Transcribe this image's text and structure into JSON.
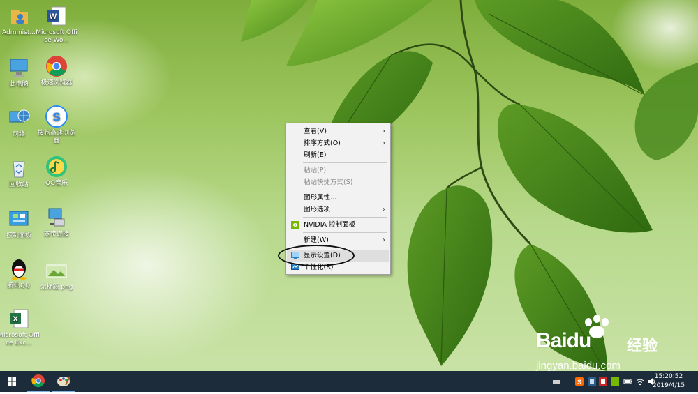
{
  "desktop_icons": [
    {
      "id": "administrator",
      "label": "Administ...",
      "icon": "user-folder-icon"
    },
    {
      "id": "word",
      "label": "Microsoft Office Wo...",
      "icon": "word-icon"
    },
    {
      "id": "this-pc",
      "label": "此电脑",
      "icon": "computer-icon"
    },
    {
      "id": "chrome",
      "label": "极速浏览器",
      "icon": "chrome-icon"
    },
    {
      "id": "network",
      "label": "网络",
      "icon": "network-globe-icon"
    },
    {
      "id": "sogou",
      "label": "搜狗高速浏览器",
      "icon": "sogou-browser-icon"
    },
    {
      "id": "recycle",
      "label": "回收站",
      "icon": "recycle-bin-icon"
    },
    {
      "id": "qqmusic",
      "label": "QQ音乐",
      "icon": "qq-music-icon"
    },
    {
      "id": "control-panel",
      "label": "控制面板",
      "icon": "control-panel-icon"
    },
    {
      "id": "broadband",
      "label": "宽带连接",
      "icon": "broadband-connection-icon"
    },
    {
      "id": "qq",
      "label": "腾讯QQ",
      "icon": "qq-penguin-icon"
    },
    {
      "id": "untitled-png",
      "label": "无标题.png",
      "icon": "image-file-icon"
    },
    {
      "id": "excel",
      "label": "Microsoft Office Exc...",
      "icon": "excel-icon"
    }
  ],
  "context_menu": {
    "items": [
      {
        "label": "查看(V)",
        "submenu": true,
        "disabled": false
      },
      {
        "label": "排序方式(O)",
        "submenu": true,
        "disabled": false
      },
      {
        "label": "刷新(E)",
        "submenu": false,
        "disabled": false
      },
      {
        "label": "粘贴(P)",
        "submenu": false,
        "disabled": true
      },
      {
        "label": "粘贴快捷方式(S)",
        "submenu": false,
        "disabled": true
      },
      {
        "label": "图形属性...",
        "submenu": false,
        "disabled": false
      },
      {
        "label": "图形选项",
        "submenu": true,
        "disabled": false
      },
      {
        "label": "NVIDIA 控制面板",
        "submenu": false,
        "disabled": false,
        "icon": "nvidia-icon"
      },
      {
        "label": "新建(W)",
        "submenu": true,
        "disabled": false
      },
      {
        "label": "显示设置(D)",
        "submenu": false,
        "disabled": false,
        "icon": "display-icon",
        "highlighted": true
      },
      {
        "label": "个性化(R)",
        "submenu": false,
        "disabled": false,
        "icon": "personalize-icon"
      }
    ],
    "arrow": "›"
  },
  "taskbar": {
    "pinned": [
      {
        "name": "start-button",
        "icon": "windows-logo-icon"
      },
      {
        "name": "chrome-taskbar",
        "icon": "chrome-icon"
      },
      {
        "name": "paint-taskbar",
        "icon": "paint-icon"
      }
    ],
    "tray_icons": [
      "sogou-input-icon",
      "app-tray-icon",
      "app-tray-icon-2",
      "nvidia-tray-icon",
      "battery-icon",
      "wifi-icon",
      "volume-icon"
    ],
    "time": "15:20:52",
    "date": "2019/4/15"
  },
  "watermark": {
    "brand": "Baidu",
    "brand_suffix": "经验",
    "url": "jingyan.baidu.com"
  },
  "colors": {
    "taskbar": "#1d2c3a",
    "menu_bg": "#f2f2f2",
    "leaf_dark": "#3f7a1a",
    "leaf_light": "#7fb83a"
  }
}
